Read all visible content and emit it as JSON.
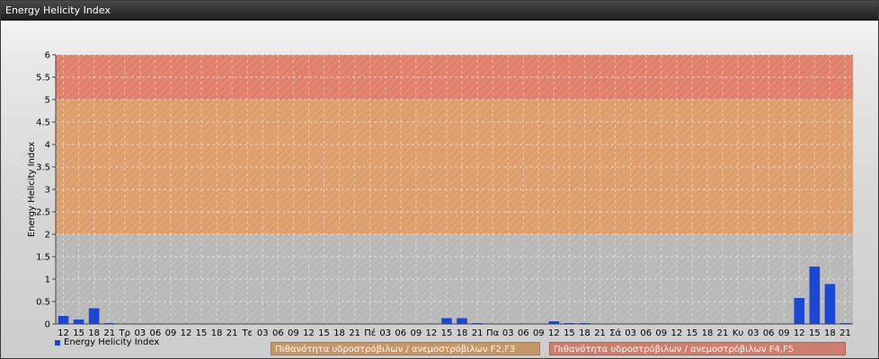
{
  "window": {
    "title": "Energy Helicity Index"
  },
  "legend": {
    "series_label": "Energy Helicity Index"
  },
  "bands": {
    "f2f3_label": "Πιθανότητα υδροστρόβιλων / ανεμοστρόβιλων F2,F3",
    "f4f5_label": "Πιθανότητα υδροστρόβιλων / ανεμοστρόβιλων F4,F5"
  },
  "colors": {
    "bar": "#1a47d6",
    "band_low": "#b8b8b8",
    "band_mid": "#dd9e6b",
    "band_high": "#e0806a"
  },
  "chart_data": {
    "type": "bar",
    "title": "",
    "xlabel": "",
    "ylabel": "Energy Helicity Index",
    "ylim": [
      0,
      6
    ],
    "yticks": [
      "0",
      "0.5",
      "1",
      "1.5",
      "2",
      "2.5",
      "3",
      "3.5",
      "4",
      "4.5",
      "5",
      "5.5",
      "6"
    ],
    "grid": true,
    "legend_position": "bottom-left",
    "bands": [
      {
        "from": 0,
        "to": 2,
        "color": "#b8b8b8"
      },
      {
        "from": 2,
        "to": 5,
        "color": "#dd9e6b"
      },
      {
        "from": 5,
        "to": 6,
        "color": "#e0806a"
      }
    ],
    "categories": [
      "12",
      "15",
      "18",
      "21",
      "Τρ",
      "03",
      "06",
      "09",
      "12",
      "15",
      "18",
      "21",
      "Τε",
      "03",
      "06",
      "09",
      "12",
      "15",
      "18",
      "21",
      "Πέ",
      "03",
      "06",
      "09",
      "12",
      "15",
      "18",
      "21",
      "Πα",
      "03",
      "06",
      "09",
      "12",
      "15",
      "18",
      "21",
      "Σά",
      "03",
      "06",
      "09",
      "12",
      "15",
      "18",
      "21",
      "Κυ",
      "03",
      "06",
      "09",
      "12",
      "15",
      "18",
      "21"
    ],
    "series": [
      {
        "name": "Energy Helicity Index",
        "values": [
          0.18,
          0.1,
          0.35,
          0.02,
          0.01,
          0.01,
          0.01,
          0.01,
          0.01,
          0.01,
          0.01,
          0.01,
          0.01,
          0.01,
          0.01,
          0.01,
          0.01,
          0.01,
          0.01,
          0.01,
          0.01,
          0.01,
          0.01,
          0.01,
          0.01,
          0.13,
          0.13,
          0.02,
          0.01,
          0.01,
          0.01,
          0.01,
          0.06,
          0.02,
          0.02,
          0.01,
          0.01,
          0.01,
          0.01,
          0.01,
          0.01,
          0.01,
          0.01,
          0.01,
          0.01,
          0.01,
          0.01,
          0.01,
          0.58,
          1.28,
          0.89,
          0.02
        ]
      }
    ]
  }
}
